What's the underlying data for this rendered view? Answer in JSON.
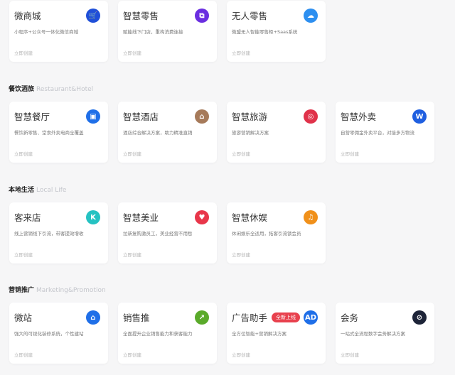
{
  "action_label": "立即创建",
  "sections": [
    {
      "title": "",
      "en": "",
      "cards": [
        {
          "title": "微商城",
          "desc": "小程序+公众号一体化微信商城",
          "icon": "cart-icon",
          "glyph": "🛒",
          "color": "#1f4fd8"
        },
        {
          "title": "智慧零售",
          "desc": "赋能线下门店，重构消费连接",
          "icon": "store-icon",
          "glyph": "⧉",
          "color": "#6a2ee0"
        },
        {
          "title": "无人零售",
          "desc": "微盟无人智能零售柜+Saas系统",
          "icon": "vending-icon",
          "glyph": "☁",
          "color": "#2d8ff0"
        }
      ]
    },
    {
      "title": "餐饮酒旅",
      "en": "Restaurant&Hotel",
      "cards": [
        {
          "title": "智慧餐厅",
          "desc": "餐饮新零售、堂食外卖电商全覆盖",
          "icon": "restaurant-icon",
          "glyph": "▣",
          "color": "#1f6fe8"
        },
        {
          "title": "智慧酒店",
          "desc": "酒店综合解决方案，助力精准直销",
          "icon": "hotel-icon",
          "glyph": "⌂",
          "color": "#a67a5a"
        },
        {
          "title": "智慧旅游",
          "desc": "旅游营销解决方案",
          "icon": "travel-icon",
          "glyph": "◎",
          "color": "#e0324a"
        },
        {
          "title": "智慧外卖",
          "desc": "自营零佣金外卖平台，对接多方物流",
          "icon": "delivery-icon",
          "glyph": "W",
          "color": "#1f5fe0"
        }
      ]
    },
    {
      "title": "本地生活",
      "en": "Local Life",
      "cards": [
        {
          "title": "客来店",
          "desc": "线上营销线下引流，带客提效增收",
          "icon": "shop-icon",
          "glyph": "K",
          "color": "#25c2c2"
        },
        {
          "title": "智慧美业",
          "desc": "拉新复购激员工，美业经营不用愁",
          "icon": "beauty-icon",
          "glyph": "♥",
          "color": "#e8364a"
        },
        {
          "title": "智慧休娱",
          "desc": "休闲娱乐全适用，拓客引流锁会员",
          "icon": "leisure-icon",
          "glyph": "♫",
          "color": "#f0901a"
        }
      ]
    },
    {
      "title": "营销推广",
      "en": "Marketing&Promotion",
      "cards": [
        {
          "title": "微站",
          "desc": "强大的可视化装修系统，个性建站",
          "icon": "website-icon",
          "glyph": "⌂",
          "color": "#1f6fe8"
        },
        {
          "title": "销售推",
          "desc": "全面提升企业销售能力和获客能力",
          "icon": "sales-icon",
          "glyph": "↗",
          "color": "#5aaa2a"
        },
        {
          "title": "广告助手",
          "badge": "全新上线",
          "desc": "全方位智能+营销解决方案",
          "icon": "ad-icon",
          "glyph": "AD",
          "color": "#1f6fe8"
        },
        {
          "title": "会务",
          "desc": "一站式全流程数字会务解决方案",
          "icon": "conference-icon",
          "glyph": "⊘",
          "color": "#1d2438"
        }
      ]
    }
  ]
}
